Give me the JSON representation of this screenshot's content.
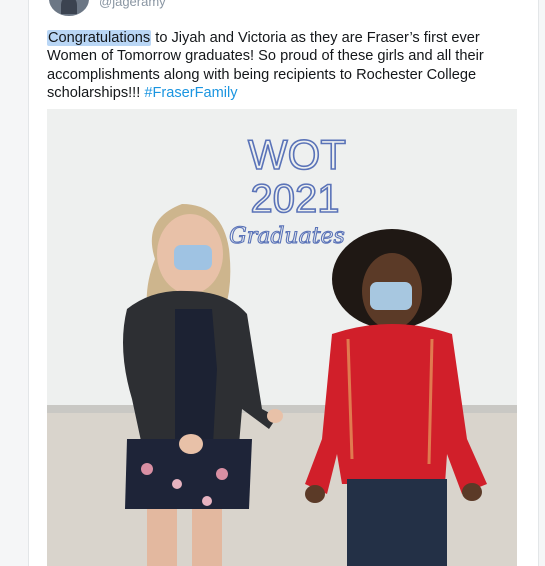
{
  "tweet": {
    "handle": "@jageramy",
    "text_highlighted": "Congratulations",
    "text_body": " to Jiyah and Victoria as they are Fraser’s first ever Women of Tomorrow graduates!  So proud of these girls and all their accomplishments along with being recipients to Rochester College scholarships!!! ",
    "hashtag": "#FraserFamily"
  },
  "photo": {
    "whiteboard_line1": "WOT",
    "whiteboard_line2": "2021",
    "whiteboard_line3": "Graduates"
  },
  "colors": {
    "hashtag": "#1b95e0",
    "highlight": "#b9d6f5",
    "marker": "#5a73b8"
  }
}
